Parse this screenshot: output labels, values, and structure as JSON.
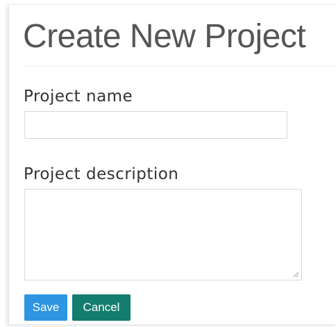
{
  "form": {
    "title": "Create New Project",
    "name_label": "Project name",
    "name_value": "",
    "description_label": "Project description",
    "description_value": "",
    "save_label": "Save",
    "cancel_label": "Cancel"
  },
  "colors": {
    "save_button": "#2d95e2",
    "cancel_button": "#137d6e",
    "title_text": "#555555"
  },
  "icons": {
    "resize_grip": "textarea-resize-grip-icon"
  }
}
